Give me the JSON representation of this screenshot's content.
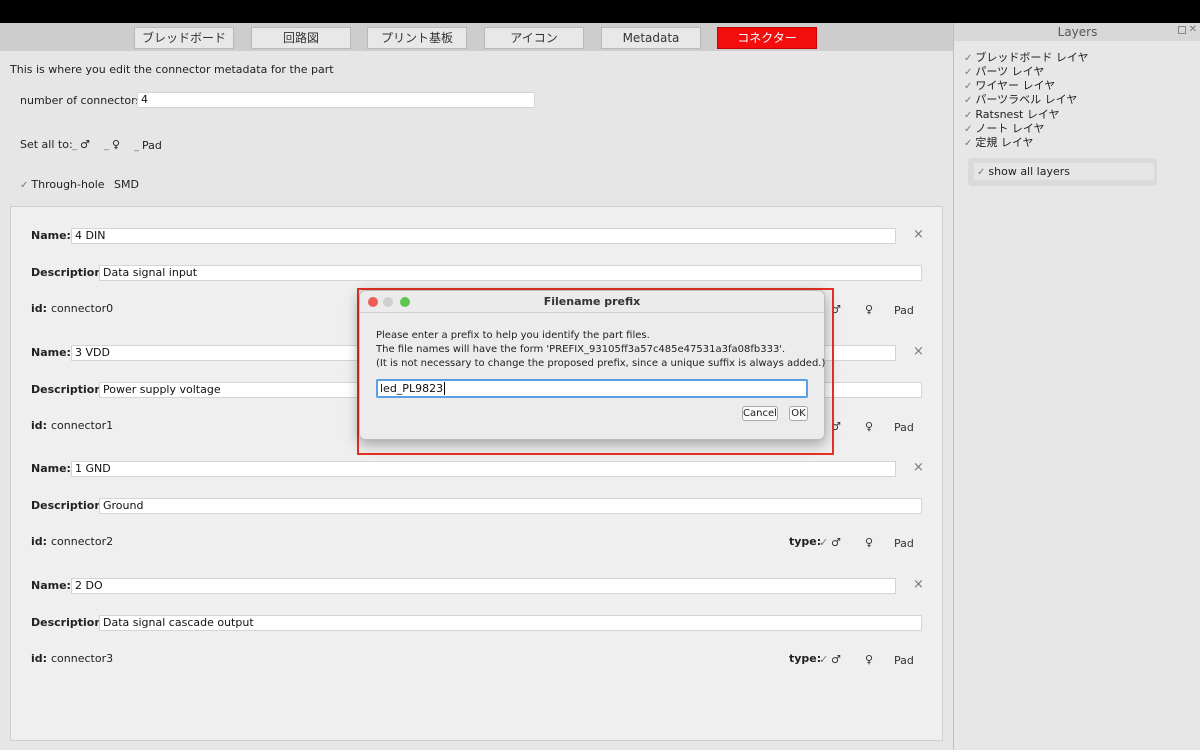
{
  "tabs": [
    "ブレッドボード",
    "回路図",
    "プリント基板",
    "アイコン",
    "Metadata",
    "コネクター"
  ],
  "intro_text": "This is where you edit the connector metadata for the part",
  "num_connectors": {
    "label": "number of connectors:",
    "value": "4"
  },
  "set_all": {
    "label": "Set all to:",
    "male": "♂",
    "female": "♀",
    "pad": "Pad"
  },
  "mount": {
    "through_hole": "Through-hole",
    "smd": "SMD"
  },
  "labels": {
    "name": "Name:",
    "description": "Description:",
    "id": "id:",
    "type": "type:"
  },
  "connectors": [
    {
      "name": "4 DIN",
      "description": "Data signal input",
      "id": "connector0",
      "male": "♂",
      "female": "♀",
      "pad": "Pad"
    },
    {
      "name": "3 VDD",
      "description": "Power supply voltage",
      "id": "connector1",
      "male": "♂",
      "female": "♀",
      "pad": "Pad"
    },
    {
      "name": "1 GND",
      "description": "Ground",
      "id": "connector2",
      "male": "♂",
      "female": "♀",
      "pad": "Pad"
    },
    {
      "name": "2 DO",
      "description": "Data signal cascade output",
      "id": "connector3",
      "male": "♂",
      "female": "♀",
      "pad": "Pad"
    }
  ],
  "close_glyph": "×",
  "layers": {
    "title": "Layers",
    "items": [
      "ブレッドボード レイヤ",
      "パーツ レイヤ",
      "ワイヤー レイヤ",
      "パーツラベル レイヤ",
      "Ratsnest レイヤ",
      "ノート レイヤ",
      "定規 レイヤ"
    ],
    "show_all": "show all layers"
  },
  "dialog": {
    "title": "Filename prefix",
    "line1": "Please enter a prefix to help you identify the part files.",
    "line2": "The file names will have the form 'PREFIX_93105ff3a57c485e47531a3fa08fb333'.",
    "line3": "(It is not necessary to change the proposed prefix, since a unique suffix is always added.)",
    "input_value": "led_PL9823",
    "cancel": "Cancel",
    "ok": "OK"
  }
}
